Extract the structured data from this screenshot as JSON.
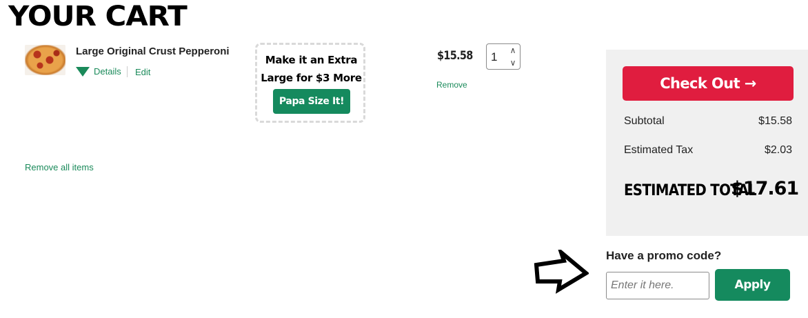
{
  "page": {
    "title": "YOUR CART"
  },
  "cart_item": {
    "name": "Large Original Crust Pepperoni",
    "thumbnail_icon": "pizza-thumbnail",
    "details_label": "Details",
    "edit_label": "Edit",
    "price": "$15.58",
    "quantity": "1",
    "remove_label": "Remove"
  },
  "upsell": {
    "line1": "Make it an Extra",
    "line2": "Large for $3 More",
    "button_label": "Papa Size It!"
  },
  "remove_all_label": "Remove all items",
  "summary": {
    "checkout_label": "Check Out →",
    "subtotal_label": "Subtotal",
    "subtotal_value": "$15.58",
    "tax_label": "Estimated Tax",
    "tax_value": "$2.03",
    "total_label": "ESTIMATED TOTAL",
    "total_value": "$17.61"
  },
  "promo": {
    "label": "Have a promo code?",
    "placeholder": "Enter it here.",
    "value": "",
    "apply_label": "Apply"
  },
  "colors": {
    "accent_green": "#158a5e",
    "checkout_red": "#e01d3f",
    "summary_bg": "#f0f0f0"
  },
  "icons": {
    "details_toggle": "triangle-down-icon",
    "qty_stepper": "chevron-up-down-icon",
    "pointer": "arrow-right-outline-icon"
  }
}
